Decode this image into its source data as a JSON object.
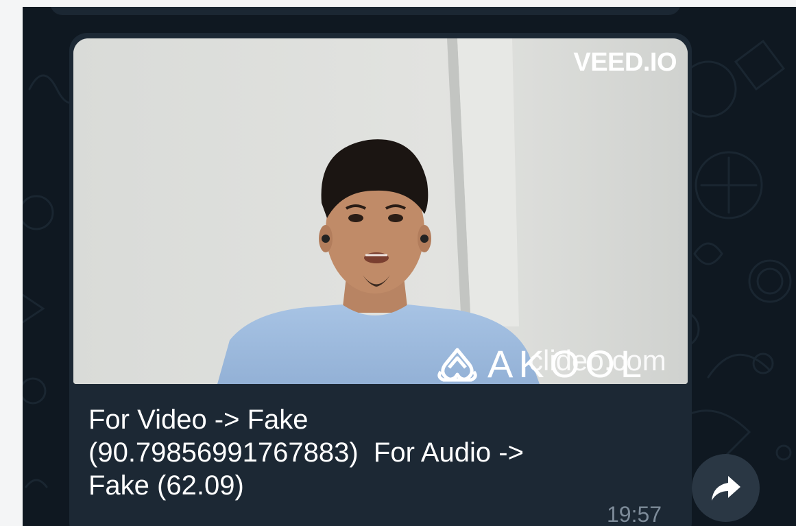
{
  "message": {
    "video": {
      "watermark_top": "VEED.IO",
      "logo_akool": "AKOOL",
      "watermark_clideo": "clideo.com"
    },
    "caption_lines": [
      "For Video -> Fake",
      "(90.79856991767883)  For Audio ->",
      "Fake (62.09)"
    ],
    "time": "19:57"
  },
  "icons": {
    "forward": "forward-arrow-icon"
  },
  "colors": {
    "chat_background": "#0f1821",
    "bubble": "#1c2834",
    "timestamp": "#7d8b99",
    "forward_button": "#2a3744"
  }
}
